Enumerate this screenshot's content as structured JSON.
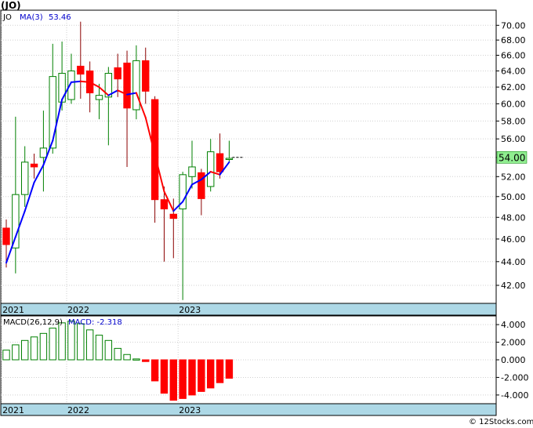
{
  "title": "(JO)",
  "copyright": "© 12Stocks.com",
  "colors": {
    "up": "#008000",
    "down": "#ff0000",
    "ma_up": "#0000ff",
    "ma_down": "#ff0000",
    "date_band": "#add8e6",
    "price_tag": "#90ee90",
    "grid": "#d0d0d0",
    "macd_label": "#0000cc"
  },
  "chart_data": [
    {
      "type": "candlestick",
      "legend": {
        "symbol": "JO",
        "ma_label": "MA(3)",
        "ma_value": "53.46"
      },
      "last_price_label": "54.00",
      "last_price": 54.0,
      "ylim": [
        40.6,
        72.0
      ],
      "yscale": "log",
      "y_ticks": [
        42,
        44,
        46,
        48,
        50,
        52,
        54,
        56,
        58,
        60,
        62,
        64,
        66,
        68,
        70
      ],
      "y_tick_labels": [
        "42.00",
        "44.00",
        "46.00",
        "48.00",
        "50.00",
        "52.00",
        "54.00",
        "56.00",
        "58.00",
        "60.00",
        "62.00",
        "64.00",
        "66.00",
        "68.00",
        "70.00"
      ],
      "x_labels": [
        {
          "label": "2021",
          "index": 0
        },
        {
          "label": "2022",
          "index": 7
        },
        {
          "label": "2023",
          "index": 19
        }
      ],
      "candles": [
        {
          "o": 47.0,
          "h": 47.8,
          "l": 43.5,
          "c": 45.5
        },
        {
          "o": 45.2,
          "h": 58.5,
          "l": 43.0,
          "c": 50.2
        },
        {
          "o": 50.2,
          "h": 55.2,
          "l": 49.0,
          "c": 53.5
        },
        {
          "o": 53.3,
          "h": 54.4,
          "l": 51.8,
          "c": 53.0
        },
        {
          "o": 54.0,
          "h": 59.2,
          "l": 50.5,
          "c": 55.0
        },
        {
          "o": 55.0,
          "h": 67.5,
          "l": 54.4,
          "c": 63.3
        },
        {
          "o": 60.2,
          "h": 67.8,
          "l": 59.2,
          "c": 63.7
        },
        {
          "o": 60.5,
          "h": 66.2,
          "l": 60.0,
          "c": 64.0
        },
        {
          "o": 64.6,
          "h": 70.5,
          "l": 60.6,
          "c": 63.6
        },
        {
          "o": 64.0,
          "h": 65.2,
          "l": 59.0,
          "c": 61.3
        },
        {
          "o": 60.5,
          "h": 62.4,
          "l": 58.2,
          "c": 61.0
        },
        {
          "o": 60.8,
          "h": 64.5,
          "l": 55.3,
          "c": 63.7
        },
        {
          "o": 64.4,
          "h": 66.2,
          "l": 60.8,
          "c": 63.0
        },
        {
          "o": 65.0,
          "h": 66.6,
          "l": 53.0,
          "c": 59.5
        },
        {
          "o": 59.3,
          "h": 67.3,
          "l": 58.2,
          "c": 65.3
        },
        {
          "o": 65.3,
          "h": 67.0,
          "l": 60.0,
          "c": 61.5
        },
        {
          "o": 60.5,
          "h": 60.9,
          "l": 47.5,
          "c": 49.7
        },
        {
          "o": 49.7,
          "h": 51.0,
          "l": 44.0,
          "c": 48.8
        },
        {
          "o": 48.3,
          "h": 49.8,
          "l": 44.3,
          "c": 47.9
        },
        {
          "o": 48.8,
          "h": 52.5,
          "l": 40.8,
          "c": 52.2
        },
        {
          "o": 52.0,
          "h": 55.8,
          "l": 50.8,
          "c": 53.0
        },
        {
          "o": 52.4,
          "h": 52.8,
          "l": 48.2,
          "c": 49.8
        },
        {
          "o": 51.0,
          "h": 56.0,
          "l": 50.5,
          "c": 54.6
        },
        {
          "o": 54.4,
          "h": 56.6,
          "l": 51.8,
          "c": 52.5
        },
        {
          "o": 53.9,
          "h": 55.8,
          "l": 53.5,
          "c": 53.9
        }
      ],
      "ma3": [
        43.9,
        46.2,
        48.6,
        51.4,
        53.2,
        55.8,
        60.5,
        62.6,
        62.7,
        62.6,
        62.0,
        61.0,
        61.6,
        61.1,
        61.3,
        58.4,
        54.3,
        50.5,
        48.6,
        49.5,
        51.2,
        51.7,
        52.5,
        52.2,
        53.5
      ],
      "ma_start_index": 0
    },
    {
      "type": "bar",
      "legend": {
        "label": "MACD(26,12,9)",
        "value_label": "MACD: -2.318"
      },
      "ylim": [
        -4.9,
        4.9
      ],
      "y_ticks": [
        -4,
        -2,
        0,
        2,
        4
      ],
      "y_tick_labels": [
        "-4.000",
        "-2.000",
        "0.000",
        "2.000",
        "4.000"
      ],
      "x_labels": [
        {
          "label": "2021",
          "index": 0
        },
        {
          "label": "2022",
          "index": 7
        },
        {
          "label": "2023",
          "index": 19
        }
      ],
      "values": [
        1.1,
        1.7,
        2.2,
        2.6,
        3.0,
        3.6,
        4.2,
        4.4,
        4.1,
        3.4,
        2.8,
        2.2,
        1.3,
        0.6,
        0.1,
        -0.2,
        -2.4,
        -3.8,
        -4.6,
        -4.4,
        -4.0,
        -3.6,
        -3.2,
        -2.6,
        -2.1
      ]
    }
  ]
}
